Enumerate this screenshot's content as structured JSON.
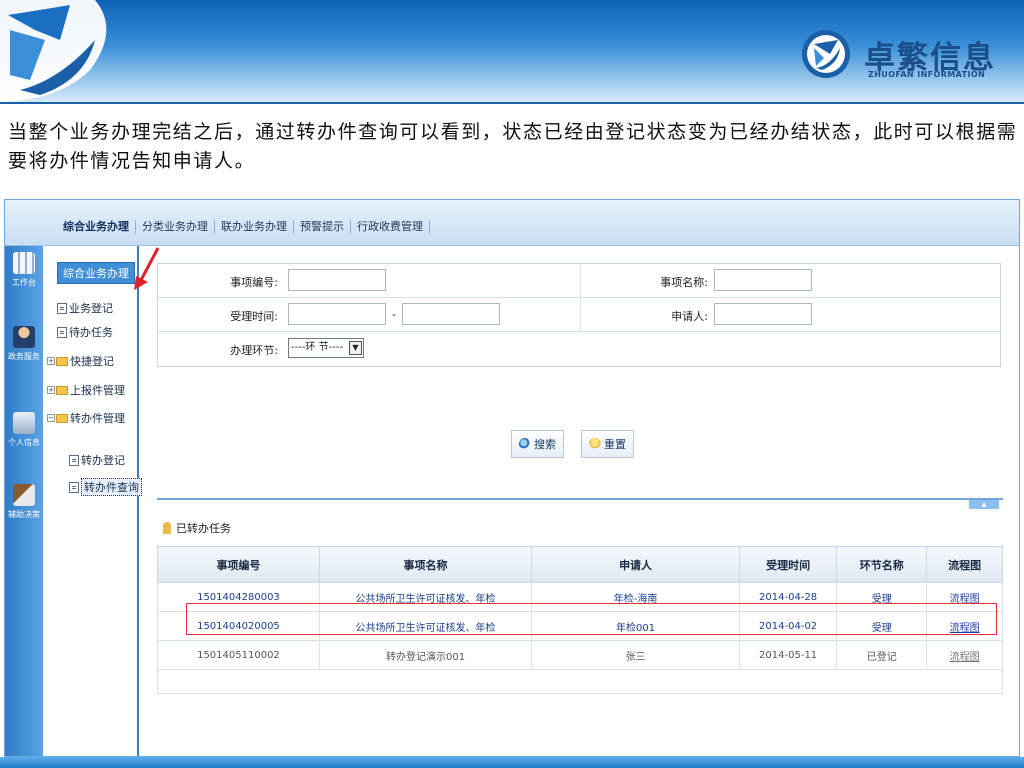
{
  "brand": {
    "name": "卓繁信息",
    "name_en": "ZHUOFAN INFORMATION"
  },
  "description": "当整个业务办理完结之后，通过转办件查询可以看到，状态已经由登记状态变为已经办结状态，此时可以根据需要将办件情况告知申请人。",
  "app": {
    "tabs": [
      {
        "label": "综合业务办理",
        "active": true
      },
      {
        "label": "分类业务办理",
        "active": false
      },
      {
        "label": "联办业务办理",
        "active": false
      },
      {
        "label": "预警提示",
        "active": false
      },
      {
        "label": "行政收费管理",
        "active": false
      }
    ],
    "leftbar": [
      {
        "label": "工作台",
        "icon": "workbench-icon"
      },
      {
        "label": "政务服务",
        "icon": "government-service-icon"
      },
      {
        "label": "个人信息",
        "icon": "personal-info-icon"
      },
      {
        "label": "辅助决策",
        "icon": "decision-support-icon"
      }
    ],
    "tree": {
      "header": "综合业务办理",
      "nodes": [
        {
          "label": "业务登记"
        },
        {
          "label": "待办任务"
        },
        {
          "label": "快捷登记"
        },
        {
          "label": "上报件管理"
        },
        {
          "label": "转办件管理"
        },
        {
          "label": "转办登记"
        },
        {
          "label": "转办件查询"
        }
      ]
    },
    "form": {
      "item_no_label": "事项编号:",
      "item_name_label": "事项名称:",
      "accept_time_label": "受理时间:",
      "date_sep": "-",
      "applicant_label": "申请人:",
      "stage_label": "办理环节:",
      "stage_value": "----环 节----",
      "search_button": "搜索",
      "reset_button": "重置"
    },
    "results": {
      "title": "已转办任务",
      "columns": [
        "事项编号",
        "事项名称",
        "申请人",
        "受理时间",
        "环节名称",
        "流程图"
      ],
      "rows": [
        [
          "1501404280003",
          "公共场所卫生许可证核发、年检",
          "年检-海南",
          "2014-04-28",
          "受理",
          "流程图"
        ],
        [
          "1501404020005",
          "公共场所卫生许可证核发、年检",
          "年检001",
          "2014-04-02",
          "受理",
          "流程图"
        ],
        [
          "1501405110002",
          "转办登记演示001",
          "张三",
          "2014-05-11",
          "已登记",
          "流程图"
        ]
      ]
    }
  },
  "colors": {
    "banner": "#0d63b8",
    "highlight": "#e0303a",
    "accent": "#3e8ed8"
  }
}
